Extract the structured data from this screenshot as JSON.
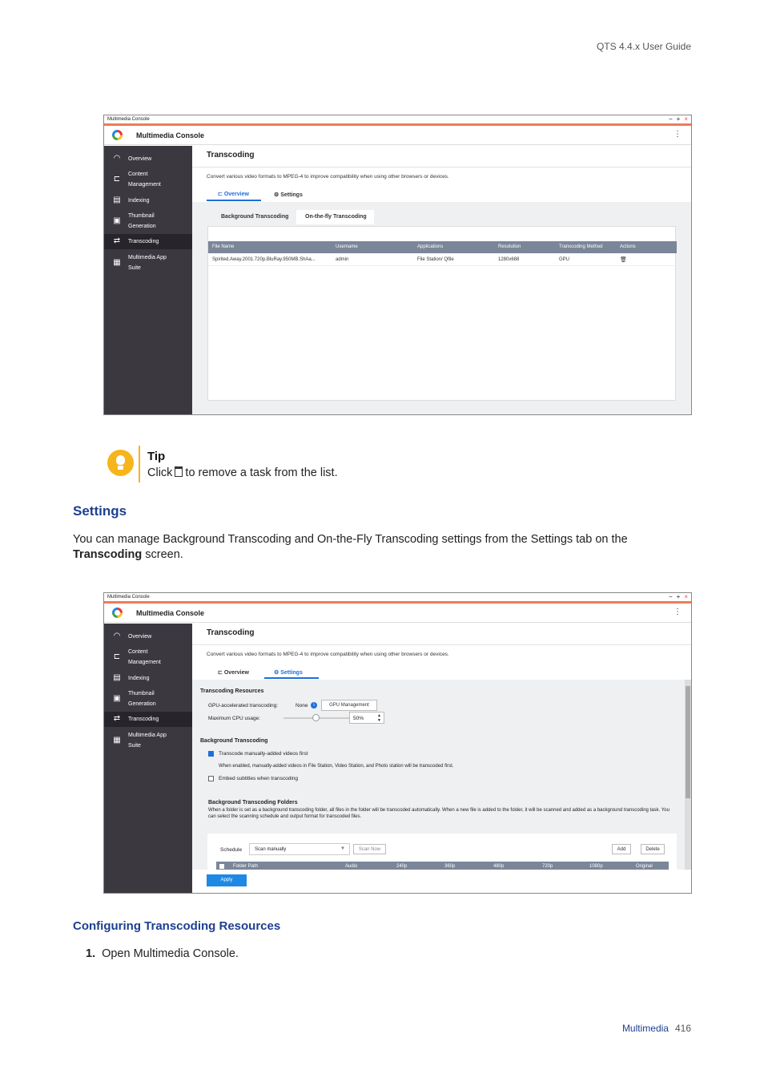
{
  "header": {
    "text": "QTS 4.4.x User Guide"
  },
  "window1": {
    "title": "Multimedia Console",
    "app_title": "Multimedia Console",
    "menu_icon": "⋮",
    "sidebar": [
      {
        "label": "Overview",
        "icon": "gauge-icon"
      },
      {
        "label": "Content\nManagement",
        "icon": "folder-search-icon"
      },
      {
        "label": "Indexing",
        "icon": "clipboard-icon"
      },
      {
        "label": "Thumbnail\nGeneration",
        "icon": "image-icon"
      },
      {
        "label": "Transcoding",
        "icon": "transcode-icon"
      },
      {
        "label": "Multimedia App\nSuite",
        "icon": "grid-icon"
      }
    ],
    "heading": "Transcoding",
    "description": "Convert various video formats to MPEG-4 to improve compatibility when using other browsers or devices.",
    "tabs": [
      "Overview",
      "Settings"
    ],
    "subtabs": [
      "Background Transcoding",
      "On-the-fly Transcoding"
    ],
    "table": {
      "headers": [
        "File Name",
        "Username",
        "Applications",
        "Resolution",
        "Transcoding Method",
        "Actions"
      ],
      "rows": [
        [
          "Spirited.Away.2001.720p.BluRay.950MB.ShAa...",
          "admin",
          "File Station/ Qfile",
          "1280x688",
          "GPU"
        ]
      ]
    }
  },
  "tip": {
    "title": "Tip",
    "text_before": "Click",
    "text_after": "to remove a task from the list."
  },
  "settings_section": {
    "title": "Settings",
    "body_1": "You can manage Background Transcoding and On-the-Fly Transcoding settings from the Settings tab on the",
    "body_bold": "Transcoding",
    "body_2": " screen."
  },
  "window2": {
    "title": "Multimedia Console",
    "app_title": "Multimedia Console",
    "menu_icon": "⋮",
    "sidebar": [
      {
        "label": "Overview"
      },
      {
        "label": "Content\nManagement"
      },
      {
        "label": "Indexing"
      },
      {
        "label": "Thumbnail\nGeneration"
      },
      {
        "label": "Transcoding"
      },
      {
        "label": "Multimedia App\nSuite"
      }
    ],
    "heading": "Transcoding",
    "description": "Convert various video formats to MPEG-4 to improve compatibility when using other browsers or devices.",
    "tabs": [
      "Overview",
      "Settings"
    ],
    "resources_title": "Transcoding Resources",
    "gpu_label": "GPU-accelerated transcoding:",
    "gpu_value": "None",
    "gpu_button": "GPU Management",
    "cpu_label": "Maximum CPU usage:",
    "cpu_value": "50%",
    "cpu_fraction": 0.5,
    "bg_title": "Background Transcoding",
    "opt1": "Transcode manually-added videos first",
    "opt1_checked": true,
    "opt1_note": "When enabled, manually-added videos in File Station, Video Station, and Photo station will be transcoded first.",
    "opt2": "Embed subtitles when transcoding",
    "opt2_checked": false,
    "folders_title": "Background Transcoding Folders",
    "folders_desc": "When a folder is set as a background transcoding folder, all files in the folder will be transcoded automatically. When a new file is added to the folder, it will be scanned and added as a background transcoding task. You can select the scanning schedule and output format for transcoded files.",
    "schedule_label": "Schedule",
    "schedule_value": "Scan manually",
    "scan_now": "Scan Now",
    "add": "Add",
    "delete": "Delete",
    "folder_headers": [
      "Folder Path",
      "Audio",
      "240p",
      "360p",
      "480p",
      "720p",
      "1080p",
      "Original"
    ],
    "apply": "Apply"
  },
  "configuring": {
    "title": "Configuring Transcoding Resources"
  },
  "step1": {
    "num": "1.",
    "text": "Open Multimedia Console."
  },
  "footer": {
    "section": "Multimedia",
    "page": "416"
  }
}
